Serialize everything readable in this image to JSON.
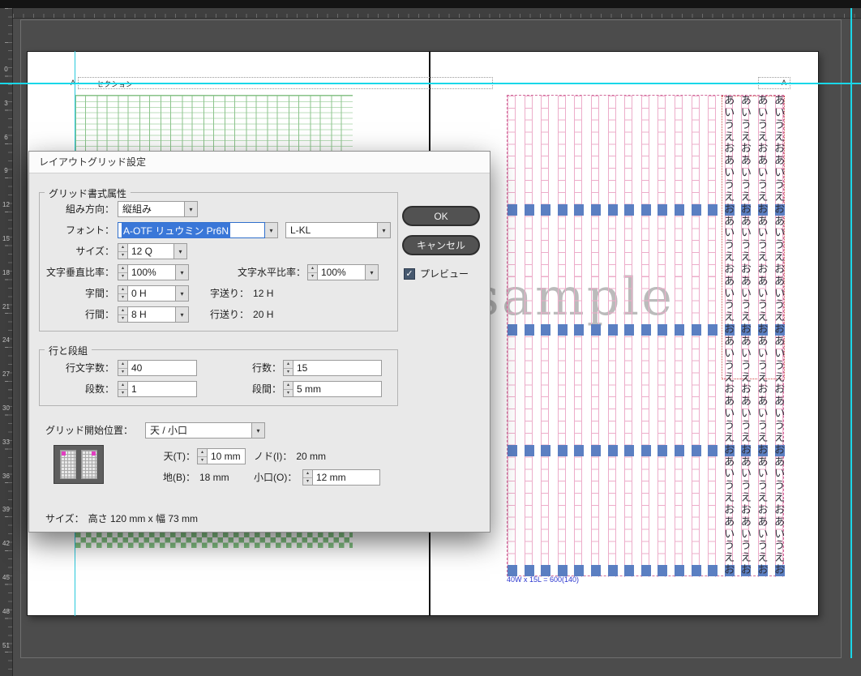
{
  "icons": {
    "chevron_down": "▾",
    "stepper_up": "▴",
    "stepper_down": "▾",
    "check": "✓"
  },
  "ruler": {
    "numbers": [
      "0",
      "3",
      "6",
      "9",
      "12",
      "15",
      "18",
      "21",
      "24",
      "27",
      "30",
      "33",
      "36",
      "39",
      "42",
      "45",
      "48",
      "51"
    ]
  },
  "page": {
    "section_marker_a_left": "A",
    "section_marker_text": "セクション",
    "section_marker_a_right": "A",
    "watermark": "sample",
    "grid_caption": "40W x 15L = 600(140)"
  },
  "grid": {
    "columns": 17,
    "rows": 40,
    "text_columns_start": 13,
    "sample_text": "あいうえお",
    "blue_rows": [
      9,
      19,
      29,
      39
    ],
    "pink_color": "#edadca",
    "blue_color": "#5b7fc2",
    "green_color": "#8cc48c"
  },
  "dialog": {
    "title": "レイアウトグリッド設定",
    "grid_attributes": {
      "section_title": "グリッド書式属性",
      "direction_label": "組み方向：",
      "direction_value": "縦組み",
      "font_label": "フォント：",
      "font_value": "A-OTF リュウミン Pr6N",
      "font_style_value": "L-KL",
      "size_label": "サイズ：",
      "size_value": "12 Q",
      "vscale_label": "文字垂直比率：",
      "vscale_value": "100%",
      "hscale_label": "文字水平比率：",
      "hscale_value": "100%",
      "charspace_label": "字間：",
      "charspace_value": "0 H",
      "charfeed_label": "字送り：",
      "charfeed_value": "12 H",
      "linespace_label": "行間：",
      "linespace_value": "8 H",
      "linefeed_label": "行送り：",
      "linefeed_value": "20 H"
    },
    "rows_columns": {
      "section_title": "行と段組",
      "chars_per_line_label": "行文字数：",
      "chars_per_line_value": "40",
      "lines_label": "行数：",
      "lines_value": "15",
      "columns_label": "段数：",
      "columns_value": "1",
      "gutter_label": "段間：",
      "gutter_value": "5 mm"
    },
    "grid_start": {
      "label": "グリッド開始位置：",
      "value": "天 / 小口",
      "top_label": "天(T)：",
      "top_value": "10 mm",
      "inside_label": "ノド(I)：",
      "inside_value": "20 mm",
      "bottom_label": "地(B)：",
      "bottom_value": "18 mm",
      "outside_label": "小口(O)：",
      "outside_value": "12 mm"
    },
    "size_label": "サイズ：",
    "size_value": "高さ 120 mm x 幅 73 mm",
    "ok_label": "OK",
    "cancel_label": "キャンセル",
    "preview_label": "プレビュー"
  }
}
